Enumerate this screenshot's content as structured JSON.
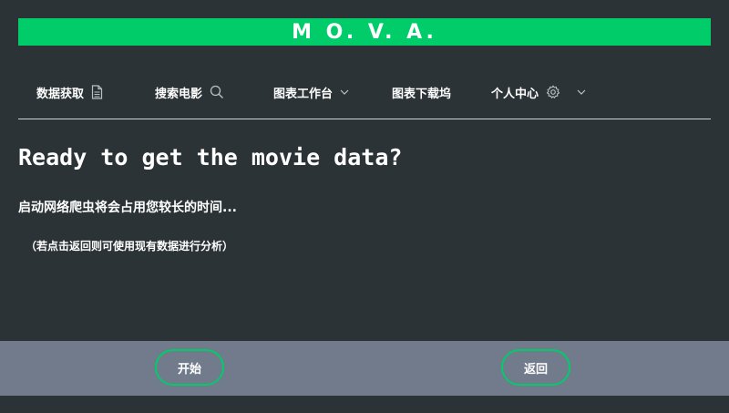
{
  "brand": {
    "title": "M O. V. A.",
    "color": "#00cc6a"
  },
  "nav": {
    "items": [
      {
        "label": "数据获取",
        "icon": "document-icon"
      },
      {
        "label": "搜索电影",
        "icon": "search-icon"
      },
      {
        "label": "图表工作台",
        "icon": "chevron-down-icon"
      },
      {
        "label": "图表下载坞"
      },
      {
        "label": "个人中心",
        "icon": "gear-icon",
        "icon2": "chevron-down-icon"
      }
    ]
  },
  "main": {
    "heading": "Ready to get the movie data?",
    "subheading": "启动网络爬虫将会占用您较长的时间...",
    "note": "（若点击返回则可使用现有数据进行分析）"
  },
  "footer": {
    "start_label": "开始",
    "back_label": "返回"
  },
  "colors": {
    "background": "#2b3336",
    "accent": "#00cc6a",
    "footer": "#717b8c"
  }
}
